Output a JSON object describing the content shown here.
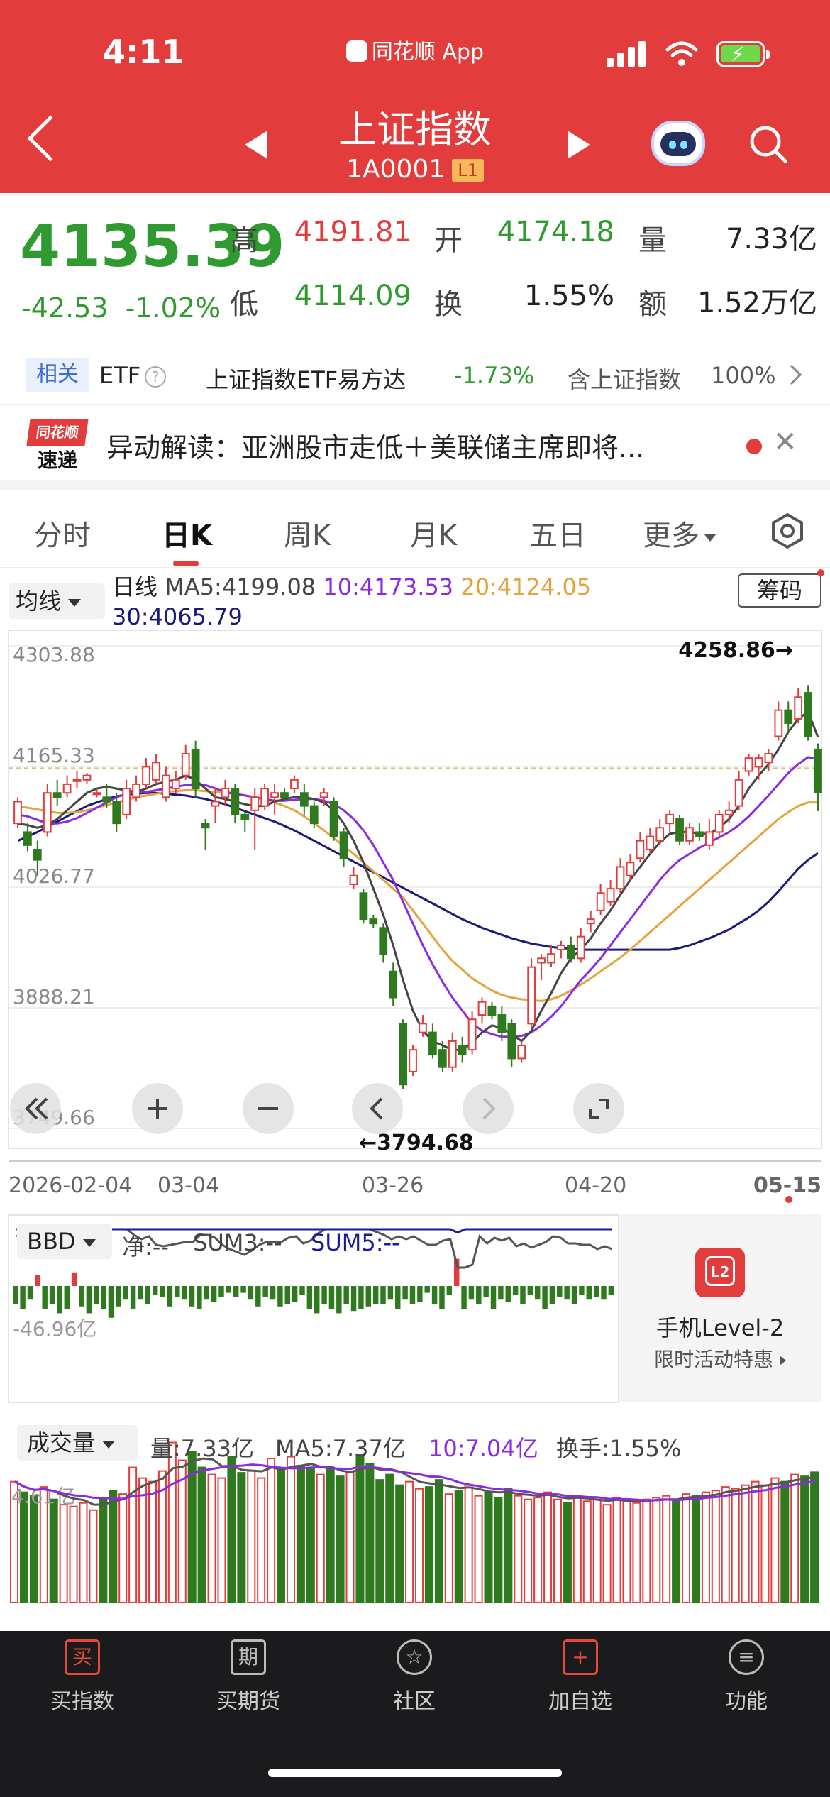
{
  "status_bar": {
    "time": "4:11",
    "app": "同花顺 App"
  },
  "header": {
    "title": "上证指数",
    "code": "1A0001",
    "level_badge": "L1"
  },
  "quote": {
    "price": "4135.39",
    "change": "-42.53",
    "change_pct": "-1.02%",
    "labels": {
      "high": "高",
      "low": "低",
      "open": "开",
      "turnover": "换",
      "volume": "量",
      "amount": "额"
    },
    "high": "4191.81",
    "low": "4114.09",
    "open": "4174.18",
    "turnover_rate": "1.55%",
    "volume": "7.33亿",
    "amount": "1.52万亿"
  },
  "related": {
    "tag": "相关",
    "etf_label": "ETF",
    "help": "?",
    "etf_name": "上证指数ETF易方达",
    "etf_change": "-1.73%",
    "contains_label": "含上证指数",
    "contains_pct": "100%"
  },
  "news": {
    "logo_top": "同花顺",
    "logo_bottom": "速递",
    "text": "异动解读：亚洲股市走低＋美联储主席即将..."
  },
  "tabs": [
    "分时",
    "日K",
    "周K",
    "月K",
    "五日",
    "更多"
  ],
  "active_tab": "日K",
  "ma_panel": {
    "selector": "均线",
    "line_type": "日线",
    "ma5": "MA5:4199.08",
    "ma10": "10:4173.53",
    "ma20": "20:4124.05",
    "ma30": "30:4065.79",
    "chip_button": "筹码"
  },
  "colors": {
    "up": "#e23c3c",
    "down": "#2f7a1f",
    "ma5": "#444444",
    "ma10": "#8a2be2",
    "ma20": "#e6a23c",
    "ma30": "#1a1a7a"
  },
  "chart_data": {
    "type": "candlestick",
    "y_ticks": [
      "4303.88",
      "4165.33",
      "4026.77",
      "3888.21",
      "3749.66"
    ],
    "ylim": [
      3749.66,
      4303.88
    ],
    "x_ticks": [
      "2026-02-04",
      "03-04",
      "03-26",
      "04-20",
      "05-15"
    ],
    "max_label": "4258.86→",
    "min_label": "←3794.68",
    "candles": [
      [
        4100,
        4125,
        4095,
        4130
      ],
      [
        4090,
        4075,
        4068,
        4100
      ],
      [
        4070,
        4058,
        4040,
        4080
      ],
      [
        4090,
        4135,
        4085,
        4145
      ],
      [
        4135,
        4130,
        4120,
        4150
      ],
      [
        4135,
        4145,
        4130,
        4155
      ],
      [
        4150,
        4150,
        4140,
        4160
      ],
      [
        4150,
        4155,
        4145,
        4158
      ],
      [
        4135,
        4135,
        4130,
        4140
      ],
      [
        4130,
        4125,
        4118,
        4145
      ],
      [
        4125,
        4100,
        4090,
        4135
      ],
      [
        4110,
        4140,
        4105,
        4150
      ],
      [
        4130,
        4145,
        4125,
        4155
      ],
      [
        4145,
        4165,
        4140,
        4175
      ],
      [
        4150,
        4170,
        4145,
        4180
      ],
      [
        4130,
        4155,
        4125,
        4165
      ],
      [
        4140,
        4150,
        4135,
        4160
      ],
      [
        4155,
        4180,
        4150,
        4190
      ],
      [
        4185,
        4140,
        4130,
        4195
      ],
      [
        4100,
        4095,
        4070,
        4105
      ],
      [
        4120,
        4125,
        4100,
        4140
      ],
      [
        4130,
        4140,
        4120,
        4150
      ],
      [
        4140,
        4110,
        4100,
        4145
      ],
      [
        4110,
        4105,
        4090,
        4115
      ],
      [
        4115,
        4130,
        4070,
        4140
      ],
      [
        4120,
        4140,
        4115,
        4145
      ],
      [
        4130,
        4135,
        4110,
        4145
      ],
      [
        4135,
        4130,
        4125,
        4140
      ],
      [
        4140,
        4150,
        4135,
        4155
      ],
      [
        4135,
        4120,
        4110,
        4145
      ],
      [
        4120,
        4100,
        4095,
        4125
      ],
      [
        4130,
        4135,
        4120,
        4140
      ],
      [
        4125,
        4085,
        4080,
        4130
      ],
      [
        4090,
        4060,
        4050,
        4095
      ],
      [
        4030,
        4040,
        4025,
        4050
      ],
      [
        4020,
        3990,
        3985,
        4025
      ],
      [
        3990,
        3985,
        3980,
        3995
      ],
      [
        3980,
        3950,
        3940,
        3985
      ],
      [
        3930,
        3900,
        3890,
        3940
      ],
      [
        3870,
        3800,
        3794.68,
        3875
      ],
      [
        3815,
        3840,
        3810,
        3845
      ],
      [
        3860,
        3870,
        3855,
        3880
      ],
      [
        3860,
        3835,
        3830,
        3870
      ],
      [
        3840,
        3820,
        3815,
        3850
      ],
      [
        3820,
        3850,
        3815,
        3860
      ],
      [
        3845,
        3835,
        3825,
        3855
      ],
      [
        3840,
        3875,
        3835,
        3885
      ],
      [
        3880,
        3895,
        3870,
        3900
      ],
      [
        3890,
        3880,
        3875,
        3895
      ],
      [
        3880,
        3860,
        3850,
        3890
      ],
      [
        3870,
        3830,
        3820,
        3875
      ],
      [
        3830,
        3845,
        3825,
        3850
      ],
      [
        3870,
        3935,
        3865,
        3945
      ],
      [
        3940,
        3945,
        3920,
        3950
      ],
      [
        3940,
        3950,
        3935,
        3960
      ],
      [
        3955,
        3960,
        3945,
        3965
      ],
      [
        3960,
        3945,
        3940,
        3970
      ],
      [
        3945,
        3970,
        3940,
        3980
      ],
      [
        3985,
        3990,
        3975,
        4000
      ],
      [
        4000,
        4020,
        3995,
        4030
      ],
      [
        4010,
        4025,
        4005,
        4035
      ],
      [
        4025,
        4050,
        4020,
        4060
      ],
      [
        4040,
        4055,
        4035,
        4065
      ],
      [
        4060,
        4080,
        4055,
        4090
      ],
      [
        4070,
        4085,
        4065,
        4095
      ],
      [
        4080,
        4095,
        4075,
        4105
      ],
      [
        4100,
        4110,
        4090,
        4115
      ],
      [
        4105,
        4080,
        4075,
        4110
      ],
      [
        4080,
        4095,
        4075,
        4100
      ],
      [
        4090,
        4085,
        4080,
        4100
      ],
      [
        4075,
        4090,
        4070,
        4105
      ],
      [
        4090,
        4110,
        4085,
        4115
      ],
      [
        4110,
        4115,
        4100,
        4125
      ],
      [
        4120,
        4150,
        4115,
        4160
      ],
      [
        4160,
        4175,
        4155,
        4180
      ],
      [
        4165,
        4175,
        4150,
        4180
      ],
      [
        4170,
        4180,
        4160,
        4185
      ],
      [
        4200,
        4230,
        4195,
        4240
      ],
      [
        4230,
        4215,
        4205,
        4240
      ],
      [
        4220,
        4245,
        4215,
        4255
      ],
      [
        4250,
        4200,
        4195,
        4258.86
      ],
      [
        4185,
        4135.39,
        4114.09,
        4191.81
      ]
    ],
    "ma": {
      "ma5": [
        4100,
        4098,
        4095,
        4098,
        4105,
        4115,
        4125,
        4135,
        4140,
        4142,
        4140,
        4138,
        4136,
        4140,
        4145,
        4148,
        4150,
        4155,
        4150,
        4140,
        4130,
        4128,
        4125,
        4122,
        4120,
        4120,
        4125,
        4128,
        4130,
        4130,
        4128,
        4124,
        4115,
        4100,
        4080,
        4055,
        4025,
        3995,
        3960,
        3920,
        3885,
        3862,
        3850,
        3845,
        3840,
        3840,
        3848,
        3860,
        3868,
        3865,
        3858,
        3850,
        3862,
        3885,
        3905,
        3928,
        3945,
        3955,
        3968,
        3985,
        4000,
        4018,
        4035,
        4050,
        4065,
        4078,
        4088,
        4090,
        4090,
        4088,
        4088,
        4095,
        4105,
        4120,
        4140,
        4155,
        4168,
        4185,
        4205,
        4220,
        4228,
        4199.08
      ],
      "ma10": [
        4110,
        4108,
        4104,
        4100,
        4100,
        4102,
        4106,
        4112,
        4118,
        4124,
        4130,
        4134,
        4136,
        4136,
        4138,
        4140,
        4142,
        4144,
        4145,
        4144,
        4140,
        4136,
        4134,
        4132,
        4130,
        4128,
        4126,
        4126,
        4127,
        4128,
        4128,
        4126,
        4122,
        4115,
        4105,
        4092,
        4075,
        4055,
        4035,
        4010,
        3985,
        3960,
        3938,
        3918,
        3900,
        3885,
        3870,
        3862,
        3858,
        3855,
        3855,
        3856,
        3860,
        3868,
        3878,
        3890,
        3905,
        3920,
        3932,
        3945,
        3960,
        3975,
        3990,
        4005,
        4020,
        4035,
        4048,
        4058,
        4065,
        4072,
        4078,
        4084,
        4090,
        4098,
        4108,
        4120,
        4132,
        4145,
        4158,
        4168,
        4176,
        4173.53
      ],
      "ma20": [
        4120,
        4118,
        4116,
        4114,
        4112,
        4112,
        4113,
        4115,
        4118,
        4121,
        4124,
        4127,
        4130,
        4132,
        4134,
        4136,
        4137,
        4138,
        4138,
        4137,
        4136,
        4135,
        4134,
        4132,
        4130,
        4127,
        4124,
        4120,
        4115,
        4108,
        4100,
        4092,
        4083,
        4074,
        4065,
        4055,
        4045,
        4035,
        4025,
        4015,
        4000,
        3985,
        3970,
        3955,
        3942,
        3932,
        3922,
        3915,
        3908,
        3903,
        3900,
        3898,
        3897,
        3896,
        3898,
        3902,
        3908,
        3915,
        3922,
        3930,
        3938,
        3946,
        3955,
        3965,
        3975,
        3985,
        3995,
        4005,
        4015,
        4025,
        4035,
        4045,
        4055,
        4065,
        4075,
        4085,
        4095,
        4105,
        4113,
        4120,
        4124,
        4124.05
      ],
      "ma30": [
        4080,
        4085,
        4090,
        4096,
        4102,
        4108,
        4114,
        4120,
        4124,
        4128,
        4131,
        4133,
        4134,
        4135,
        4135,
        4134,
        4133,
        4132,
        4130,
        4128,
        4125,
        4122,
        4118,
        4114,
        4110,
        4106,
        4102,
        4097,
        4092,
        4086,
        4080,
        4074,
        4068,
        4062,
        4056,
        4050,
        4044,
        4038,
        4032,
        4026,
        4020,
        4014,
        4008,
        4002,
        3996,
        3990,
        3985,
        3980,
        3976,
        3972,
        3968,
        3965,
        3962,
        3960,
        3958,
        3957,
        3956,
        3955,
        3955,
        3955,
        3955,
        3955,
        3955,
        3955,
        3955,
        3955,
        3955,
        3957,
        3960,
        3964,
        3968,
        3973,
        3978,
        3985,
        3992,
        4000,
        4010,
        4022,
        4035,
        4048,
        4058,
        4065.79
      ]
    }
  },
  "controls": [
    "«",
    "+",
    "−",
    "‹",
    "›",
    "⤢"
  ],
  "bbd": {
    "selector": "BBD",
    "net": "净:--",
    "sum3": "SUM3:--",
    "sum5": "SUM5:--",
    "axis_label": "-46.96亿",
    "values": [
      -8,
      -10,
      -6,
      5,
      -10,
      -8,
      -12,
      -10,
      6,
      -9,
      -12,
      -8,
      -10,
      -14,
      -9,
      -6,
      -10,
      -6,
      -8,
      -4,
      -5,
      -9,
      -5,
      -6,
      -9,
      -10,
      -6,
      -7,
      -5,
      -3,
      -5,
      -3,
      -6,
      -9,
      -5,
      -6,
      -9,
      -8,
      -7,
      -4,
      -10,
      -12,
      -8,
      -10,
      -12,
      -8,
      -11,
      -10,
      -9,
      -8,
      -8,
      -6,
      -10,
      -6,
      -8,
      -7,
      -3,
      -8,
      -10,
      -4,
      12,
      -10,
      -6,
      -8,
      -5,
      -10,
      -6,
      -7,
      -4,
      -8,
      -4,
      -6,
      -10,
      -8,
      -5,
      -6,
      -8,
      -4,
      -6,
      -5,
      -6,
      -4
    ]
  },
  "l2_promo": {
    "icon": "L2",
    "title": "手机Level-2",
    "subtitle": "限时活动特惠"
  },
  "volume": {
    "selector": "成交量",
    "vol": "量:7.33亿",
    "ma5": "MA5:7.37亿",
    "ma10": "10:7.04亿",
    "turnover": "换手:1.55%",
    "axis_label": "4.61亿",
    "values": [
      6.8,
      6.2,
      6.0,
      6.5,
      5.8,
      5.5,
      5.4,
      5.6,
      5.2,
      5.9,
      6.3,
      6.1,
      7.6,
      7.0,
      6.8,
      7.4,
      9.0,
      8.0,
      8.5,
      7.6,
      7.2,
      7.0,
      8.2,
      7.3,
      7.4,
      7.0,
      8.1,
      7.5,
      8.2,
      7.7,
      7.5,
      7.2,
      7.6,
      7.1,
      7.3,
      8.3,
      7.8,
      6.9,
      7.2,
      6.6,
      6.8,
      6.4,
      6.5,
      6.9,
      6.1,
      6.3,
      6.6,
      6.0,
      6.2,
      5.9,
      6.4,
      6.0,
      5.8,
      5.9,
      6.2,
      5.8,
      5.6,
      6.0,
      5.7,
      5.8,
      5.5,
      5.9,
      5.7,
      5.6,
      5.8,
      5.9,
      6.0,
      5.7,
      6.1,
      6.0,
      6.2,
      6.3,
      6.5,
      6.4,
      6.6,
      6.8,
      6.6,
      7.0,
      6.8,
      7.2,
      7.1,
      7.33
    ]
  },
  "bottom_nav": [
    {
      "icon": "买",
      "label": "买指数"
    },
    {
      "icon": "期",
      "label": "买期货"
    },
    {
      "icon": "☆",
      "label": "社区"
    },
    {
      "icon": "+",
      "label": "加自选"
    },
    {
      "icon": "≡",
      "label": "功能"
    }
  ]
}
